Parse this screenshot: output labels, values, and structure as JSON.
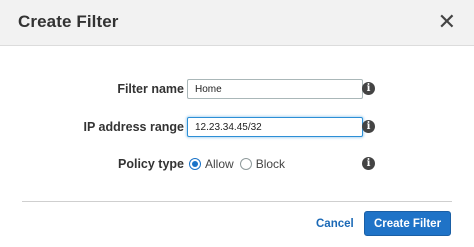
{
  "dialog": {
    "title": "Create Filter",
    "close_icon": "close-icon",
    "close_glyph": "✕"
  },
  "form": {
    "filter_name": {
      "label": "Filter name",
      "value": "Home",
      "info_icon": "info-icon"
    },
    "ip_range": {
      "label": "IP address range",
      "value": "12.23.34.45/32",
      "info_icon": "info-icon"
    },
    "policy_type": {
      "label": "Policy type",
      "options": [
        {
          "label": "Allow",
          "selected": true
        },
        {
          "label": "Block",
          "selected": false
        }
      ],
      "info_icon": "info-icon"
    },
    "info_glyph": "i"
  },
  "footer": {
    "cancel_label": "Cancel",
    "submit_label": "Create Filter"
  },
  "colors": {
    "primary": "#1f73c7",
    "link": "#1b69b6",
    "focus": "#2c8fd6",
    "header_bg": "#f2f2f2"
  }
}
